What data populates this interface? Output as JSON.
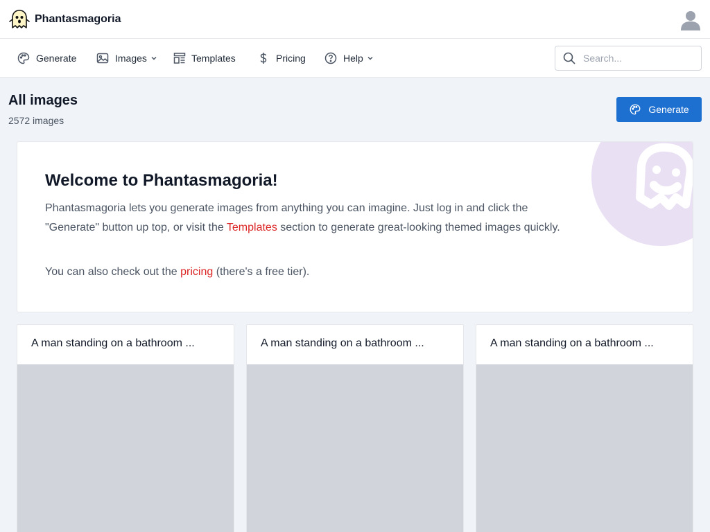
{
  "app": {
    "name": "Phantasmagoria"
  },
  "nav": {
    "generate": "Generate",
    "images": "Images",
    "templates": "Templates",
    "pricing": "Pricing",
    "help": "Help"
  },
  "search": {
    "placeholder": "Search..."
  },
  "page": {
    "title": "All images",
    "count": "2572 images",
    "generate_button": "Generate"
  },
  "welcome": {
    "title": "Welcome to Phantasmagoria!",
    "p1_a": "Phantasmagoria lets you generate images from anything you can imagine. Just log in and click the \"Generate\" button up top, or visit the ",
    "p1_link": "Templates",
    "p1_b": " section to generate great-looking themed images quickly.",
    "p2_a": "You can also check out the ",
    "p2_link": "pricing",
    "p2_b": " (there's a free tier)."
  },
  "cards": [
    {
      "title": "A man standing on a bathroom ..."
    },
    {
      "title": "A man standing on a bathroom ..."
    },
    {
      "title": "A man standing on a bathroom ..."
    }
  ],
  "colors": {
    "accent": "#1d6fd0",
    "link": "#dc2626",
    "background": "#f0f3f7",
    "decoration": "#e9e0f4"
  }
}
